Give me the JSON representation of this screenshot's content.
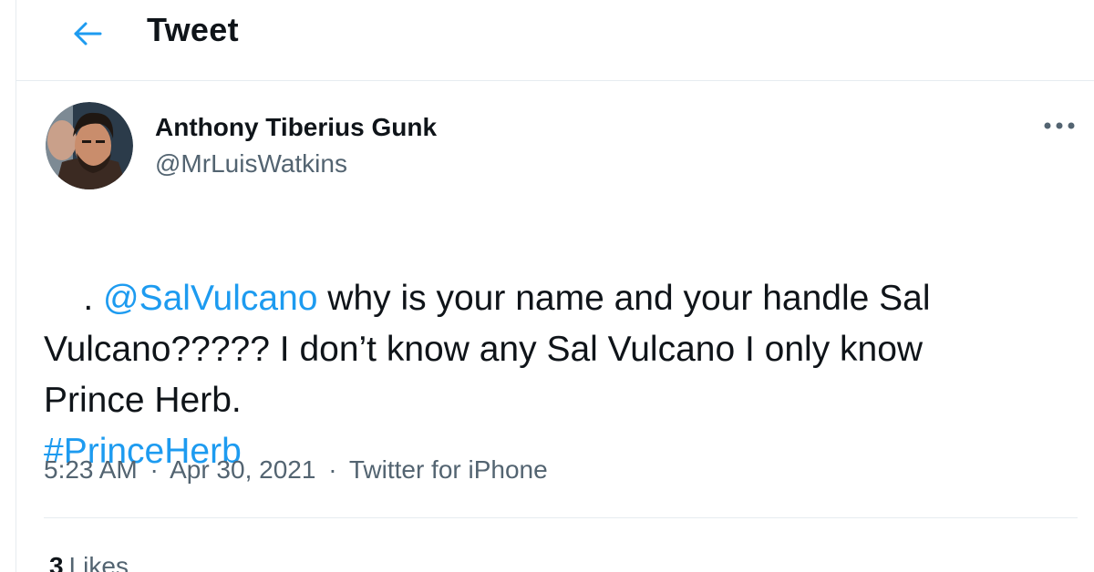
{
  "header": {
    "back_icon": "arrow-left-icon",
    "title": "Tweet"
  },
  "author": {
    "name": "Anthony Tiberius Gunk",
    "handle": "@MrLuisWatkins",
    "avatar_icon": "user-avatar"
  },
  "more_icon": "ellipsis-icon",
  "tweet": {
    "segments": [
      {
        "text": ". ",
        "link": false
      },
      {
        "text": "@SalVulcano",
        "link": true
      },
      {
        "text": " why is your name and your handle Sal\nVulcano????? I don’t know any Sal Vulcano I only know\nPrince Herb.\n",
        "link": false
      },
      {
        "text": "#PrinceHerb",
        "link": true
      }
    ]
  },
  "meta": {
    "time": "5:23 AM",
    "separator": "·",
    "date": "Apr 30, 2021",
    "source": "Twitter for iPhone"
  },
  "stats": {
    "likes_count": "3",
    "likes_label": "Likes"
  },
  "colors": {
    "accent": "#1d9bf0",
    "text_primary": "#0f1419",
    "text_secondary": "#536471",
    "border": "#e6ecf0"
  }
}
